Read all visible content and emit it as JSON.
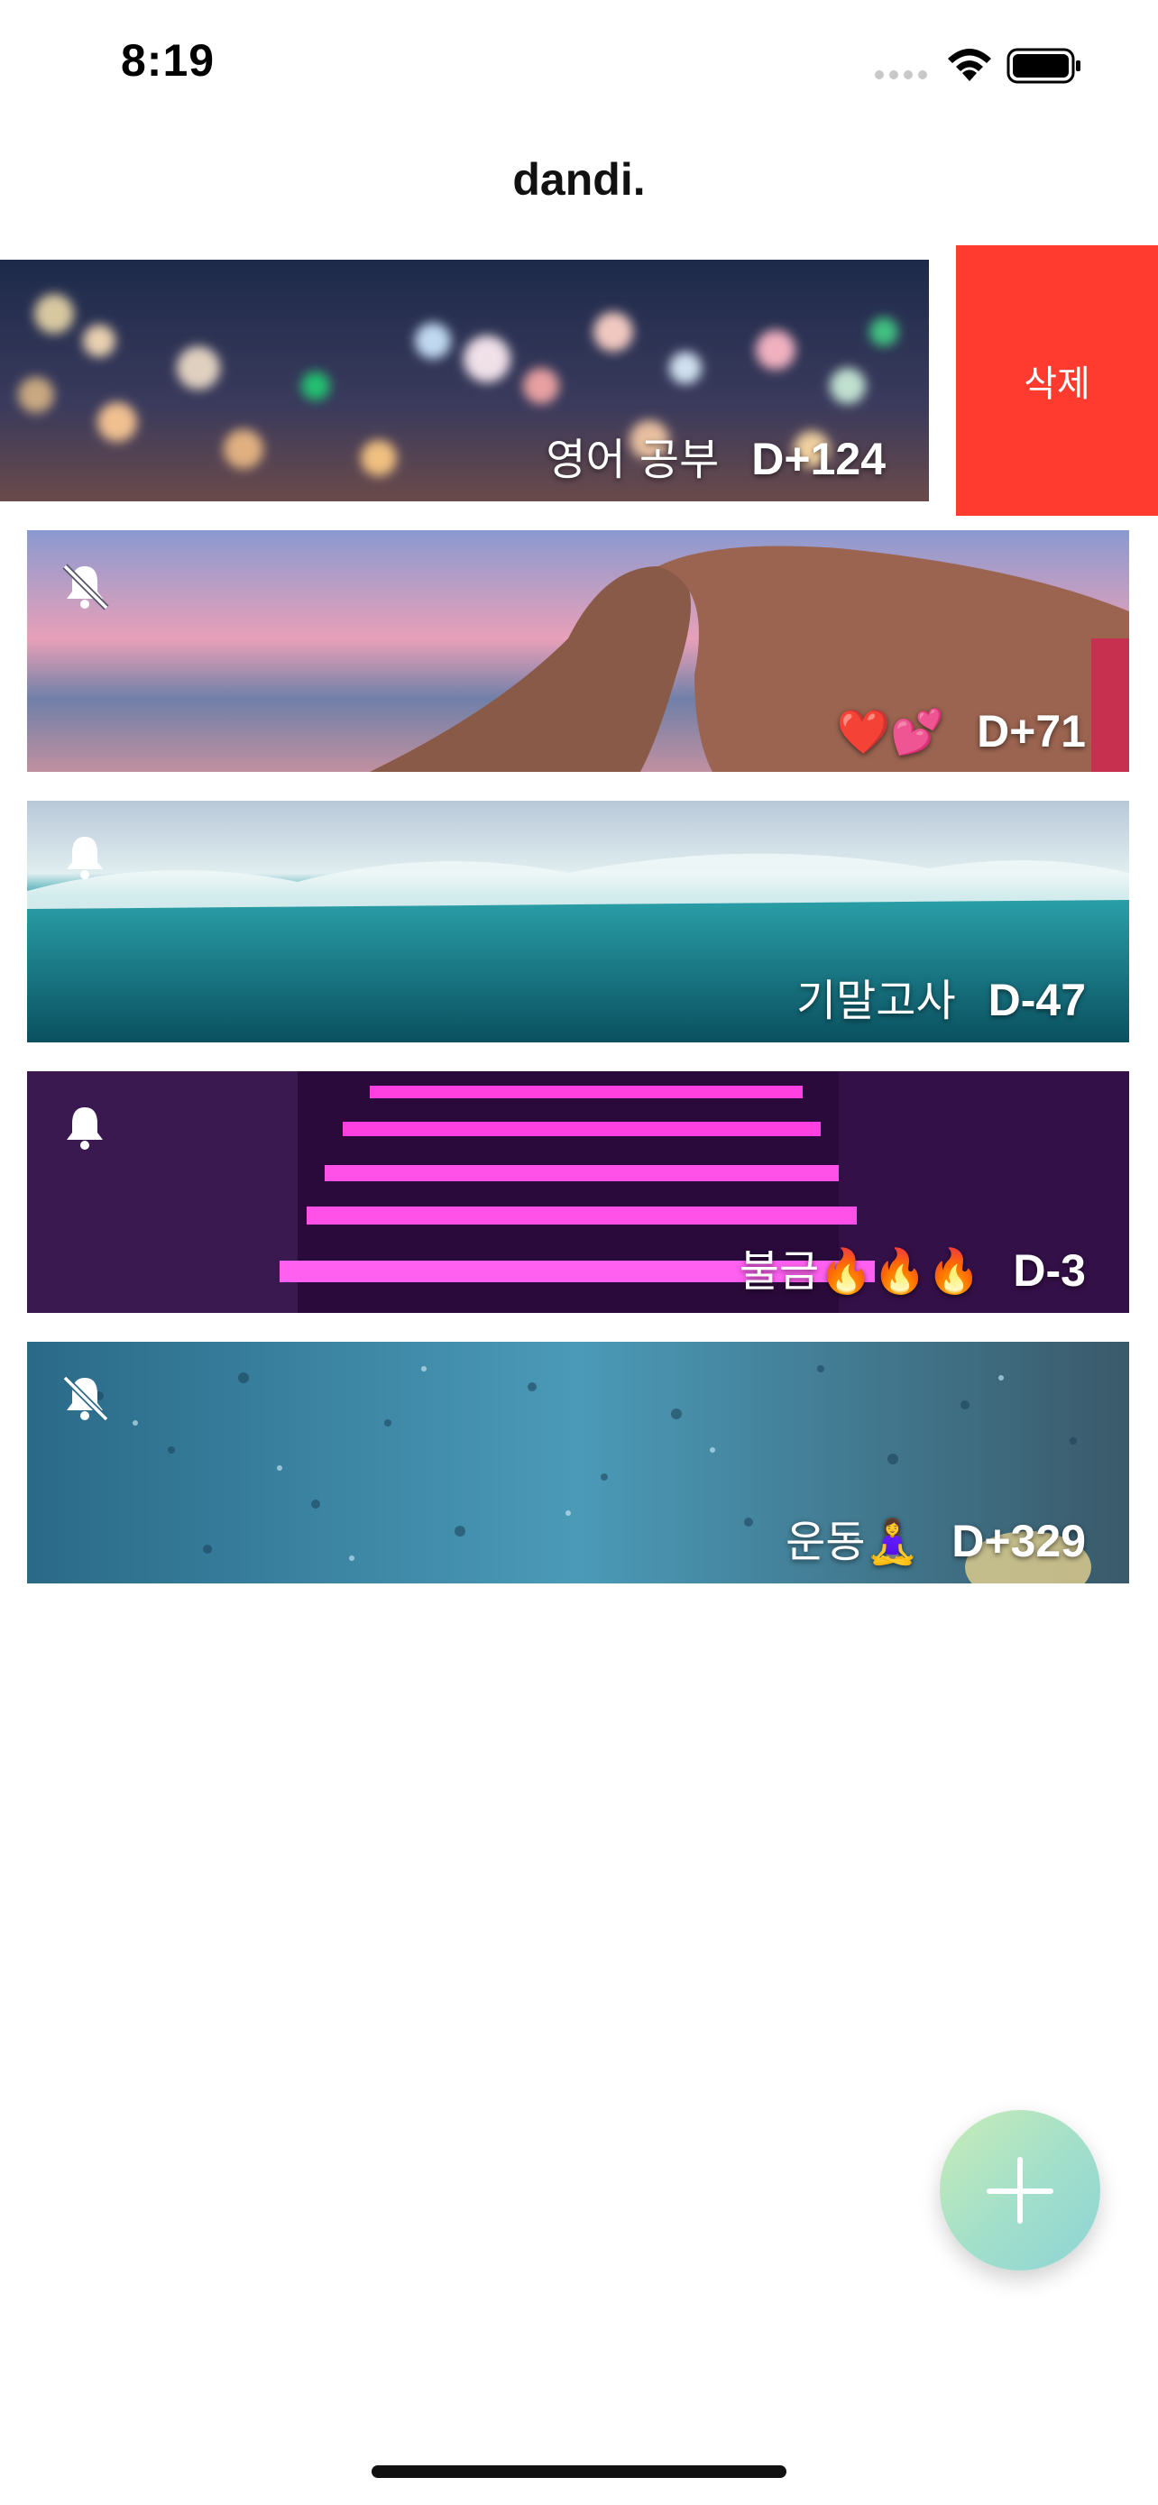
{
  "status": {
    "time": "8:19"
  },
  "app": {
    "title": "dandi."
  },
  "swipe_action": {
    "delete_label": "삭제"
  },
  "cards": [
    {
      "name": "영어 공부",
      "dday": "D+124",
      "alarm": "none"
    },
    {
      "name": "❤️💕",
      "dday": "D+71",
      "alarm": "off"
    },
    {
      "name": "기말고사",
      "dday": "D-47",
      "alarm": "on"
    },
    {
      "name": "불금🔥🔥🔥",
      "dday": "D-3",
      "alarm": "on"
    },
    {
      "name": "운동🧘‍♀️",
      "dday": "D+329",
      "alarm": "off"
    }
  ],
  "colors": {
    "delete": "#ff3b30",
    "fab_gradient": [
      "#c9ecb6",
      "#8dd4d6"
    ]
  },
  "icons": {
    "bell_on": "bell-icon",
    "bell_off": "bell-slash-icon",
    "add": "plus-icon"
  }
}
